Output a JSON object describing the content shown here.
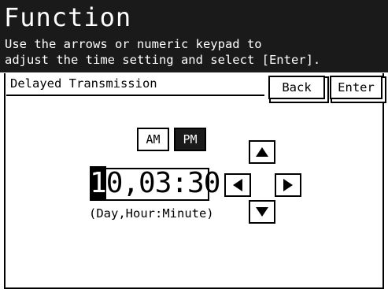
{
  "header": {
    "title": "Function",
    "instruction_line1": "Use the arrows or numeric keypad to",
    "instruction_line2": "adjust the time setting and select [Enter]."
  },
  "breadcrumb": "Delayed Transmission",
  "buttons": {
    "back": "Back",
    "enter": "Enter"
  },
  "ampm": {
    "am": "AM",
    "pm": "PM",
    "selected": "PM"
  },
  "time": {
    "cursor_digit": "1",
    "rest": "0,03:30"
  },
  "hint": "(Day,Hour:Minute)",
  "icons": {
    "up": "arrow-up-icon",
    "down": "arrow-down-icon",
    "left": "arrow-left-icon",
    "right": "arrow-right-icon"
  },
  "colors": {
    "header_bg": "#1a1a1a",
    "selected_bg": "#1a1a1a"
  }
}
